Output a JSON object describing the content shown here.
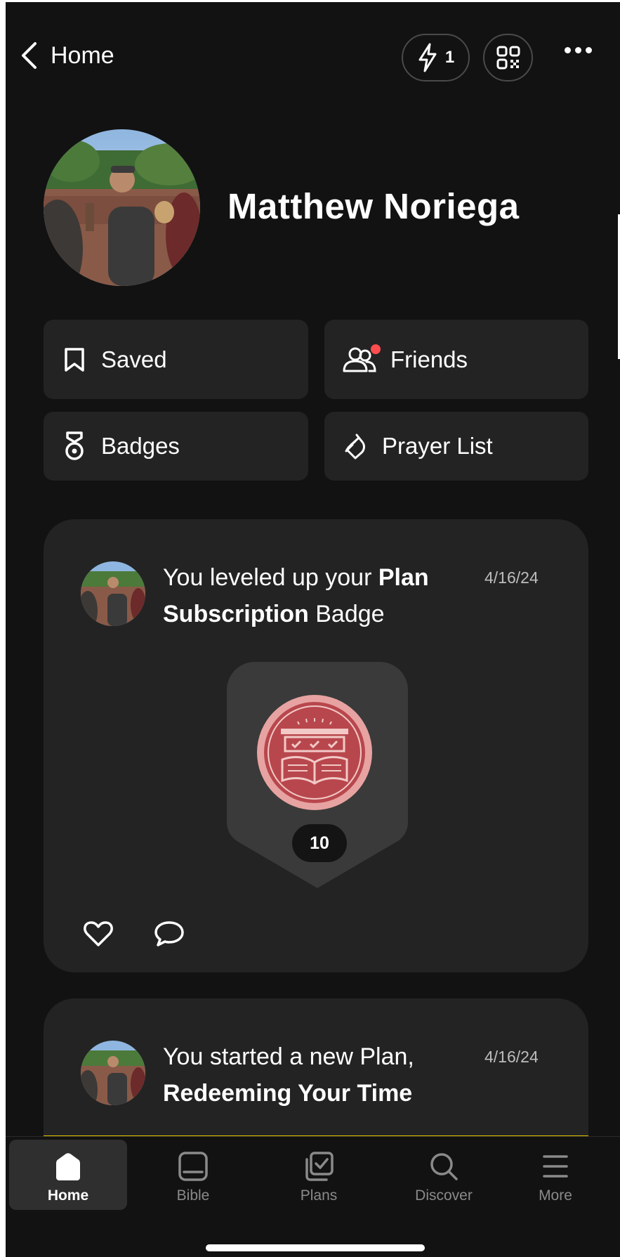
{
  "header": {
    "back_label": "Home",
    "streak_count": "1"
  },
  "profile": {
    "name": "Matthew Noriega"
  },
  "quick_actions": [
    {
      "label": "Saved",
      "icon": "bookmark-icon"
    },
    {
      "label": "Friends",
      "icon": "friends-icon",
      "has_notification": true
    },
    {
      "label": "Badges",
      "icon": "medal-icon"
    },
    {
      "label": "Prayer List",
      "icon": "praying-hands-icon"
    }
  ],
  "feed": [
    {
      "text_prefix": "You leveled up your ",
      "text_bold": "Plan Subscription",
      "text_suffix": " Badge",
      "date": "4/16/24",
      "badge_level": "10"
    },
    {
      "text_prefix": "You started a new Plan,",
      "text_bold": "Redeeming Your Time",
      "text_suffix": "",
      "date": "4/16/24"
    }
  ],
  "bottom_nav": [
    {
      "label": "Home",
      "icon": "home-icon",
      "active": true
    },
    {
      "label": "Bible",
      "icon": "bible-icon",
      "active": false
    },
    {
      "label": "Plans",
      "icon": "plans-icon",
      "active": false
    },
    {
      "label": "Discover",
      "icon": "search-icon",
      "active": false
    },
    {
      "label": "More",
      "icon": "menu-icon",
      "active": false
    }
  ],
  "colors": {
    "background": "#121212",
    "card": "#232323",
    "badge_accent": "#c94f55",
    "notification_dot": "#ff4d4f"
  }
}
